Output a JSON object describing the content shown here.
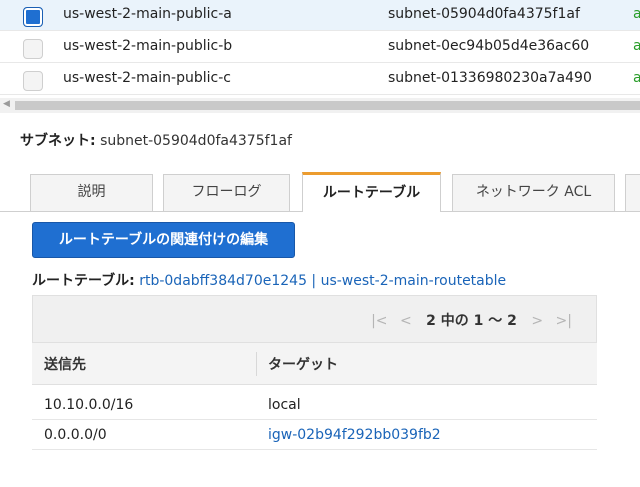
{
  "subnets": [
    {
      "name": "us-west-2-main-public-a",
      "id": "subnet-05904d0fa4375f1af",
      "trunc": "a",
      "checked": true
    },
    {
      "name": "us-west-2-main-public-b",
      "id": "subnet-0ec94b05d4e36ac60",
      "trunc": "a",
      "checked": false
    },
    {
      "name": "us-west-2-main-public-c",
      "id": "subnet-01336980230a7a490",
      "trunc": "a",
      "checked": false
    }
  ],
  "detail": {
    "subnet_label": "サブネット:",
    "subnet_value": "subnet-05904d0fa4375f1af"
  },
  "tabs": [
    {
      "label": "説明"
    },
    {
      "label": "フローログ"
    },
    {
      "label": "ルートテーブル"
    },
    {
      "label": "ネットワーク ACL"
    }
  ],
  "route_table": {
    "edit_button": "ルートテーブルの関連付けの編集",
    "label": "ルートテーブル:",
    "link": "rtb-0dabff384d70e1245 | us-west-2-main-routetable",
    "pager": {
      "first": "|<",
      "prev": "<",
      "count": "2 中の 1 ～ 2",
      "next": ">",
      "last": ">|"
    },
    "columns": {
      "destination": "送信先",
      "target": "ターゲット"
    },
    "rows": [
      {
        "destination": "10.10.0.0/16",
        "target": "local"
      },
      {
        "destination": "0.0.0.0/0",
        "target": "igw-02b94f292bb039fb2"
      }
    ]
  },
  "colors": {
    "accent": "#1f6fd1",
    "tab_active": "#ec9c2f",
    "link": "#1a64b8"
  }
}
